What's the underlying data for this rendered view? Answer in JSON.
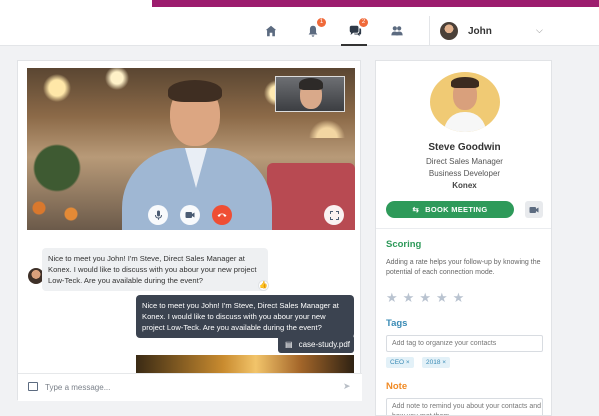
{
  "colors": {
    "brand_bar": "#9c1d6e",
    "primary_green": "#2e9a5a",
    "scoring_title": "#2e9a5a",
    "tags_title": "#3a8bb5",
    "note_title": "#f08a24",
    "end_call": "#ef4e34",
    "badge": "#f06a3a"
  },
  "nav": {
    "icons": [
      "home-icon",
      "bell-icon",
      "chat-icon",
      "people-icon"
    ],
    "bell_badge": "1",
    "chat_badge": "2",
    "user_name": "John",
    "chevron": "⌵"
  },
  "video_call": {
    "controls": [
      "mic-icon",
      "camera-icon",
      "end-call-icon",
      "fullscreen-icon"
    ]
  },
  "chat": {
    "messages": [
      {
        "direction": "incoming",
        "text": "Nice to meet you John! I'm Steve, Direct Sales Manager at Konex. I would like to discuss with you abour your new project Low-Teck. Are you available during the event?"
      },
      {
        "direction": "outgoing",
        "text": "Nice to meet you John! I'm Steve, Direct Sales Manager at Konex. I would like to discuss with you abour your new project Low-Teck. Are you available during the event?"
      }
    ],
    "attachment": "case-study.pdf",
    "composer_placeholder": "Type a message..."
  },
  "profile": {
    "name": "Steve Goodwin",
    "role_1": "Direct Sales Manager",
    "role_2": "Business Developer",
    "company": "Konex",
    "book_label": "BOOK MEETING",
    "scoring": {
      "title": "Scoring",
      "description": "Adding a rate helps your follow-up by knowing the potential of each connection mode.",
      "stars_total": 5,
      "stars_filled": 0
    },
    "tags": {
      "title": "Tags",
      "input_placeholder": "Add tag to organize your contacts",
      "items": [
        "CEO ×",
        "2018 ×"
      ]
    },
    "note": {
      "title": "Note",
      "placeholder": "Add note to remind you about your contacts and how you met them"
    }
  }
}
